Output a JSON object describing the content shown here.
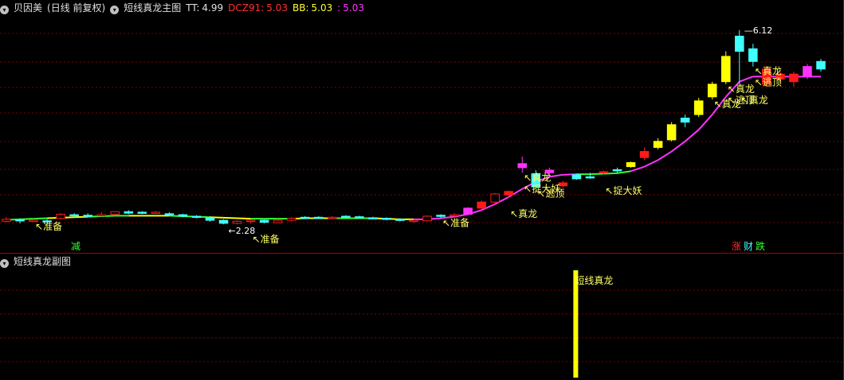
{
  "main_header": {
    "stock_name": "贝因美",
    "period": "(日线 前复权)",
    "indicator_name": "短线真龙主图",
    "tt_label": "TT:",
    "tt_value": "4.99",
    "dcz_label": "DCZ91:",
    "dcz_value": "5.03",
    "bb_label": "BB:",
    "bb_value": "5.03",
    "extra_label": ":",
    "extra_value": "5.03"
  },
  "sub_header": {
    "indicator_name": "短线真龙副图"
  },
  "bottom_tags": {
    "left": "减",
    "zhang": "涨",
    "cai": "财",
    "die": "跌"
  },
  "colors": {
    "up": "#ff1a1a",
    "down": "#40ffff",
    "yellow": "#ffff00",
    "magenta": "#ff33ff",
    "green": "#33ff33",
    "grid": "#7a0000",
    "annotation": "#ffff66",
    "price_label": "#ffffff"
  },
  "chart_data": {
    "type": "candlestick",
    "price_range": [
      2.0,
      6.4
    ],
    "candles": [
      {
        "o": 2.38,
        "h": 2.42,
        "l": 2.32,
        "c": 2.34
      },
      {
        "o": 2.36,
        "h": 2.4,
        "l": 2.3,
        "c": 2.37
      },
      {
        "o": 2.36,
        "h": 2.4,
        "l": 2.33,
        "c": 2.35
      },
      {
        "o": 2.35,
        "h": 2.38,
        "l": 2.3,
        "c": 2.33
      },
      {
        "o": 2.4,
        "h": 2.5,
        "l": 2.38,
        "c": 2.48
      },
      {
        "o": 2.47,
        "h": 2.5,
        "l": 2.43,
        "c": 2.45
      },
      {
        "o": 2.46,
        "h": 2.5,
        "l": 2.44,
        "c": 2.46
      },
      {
        "o": 2.47,
        "h": 2.52,
        "l": 2.45,
        "c": 2.47
      },
      {
        "o": 2.48,
        "h": 2.54,
        "l": 2.46,
        "c": 2.53
      },
      {
        "o": 2.53,
        "h": 2.56,
        "l": 2.48,
        "c": 2.5
      },
      {
        "o": 2.51,
        "h": 2.54,
        "l": 2.48,
        "c": 2.52
      },
      {
        "o": 2.52,
        "h": 2.54,
        "l": 2.49,
        "c": 2.51
      },
      {
        "o": 2.49,
        "h": 2.52,
        "l": 2.45,
        "c": 2.47
      },
      {
        "o": 2.47,
        "h": 2.49,
        "l": 2.42,
        "c": 2.44
      },
      {
        "o": 2.44,
        "h": 2.46,
        "l": 2.4,
        "c": 2.42
      },
      {
        "o": 2.41,
        "h": 2.44,
        "l": 2.33,
        "c": 2.36
      },
      {
        "o": 2.36,
        "h": 2.38,
        "l": 2.28,
        "c": 2.3
      },
      {
        "o": 2.3,
        "h": 2.36,
        "l": 2.28,
        "c": 2.34
      },
      {
        "o": 2.34,
        "h": 2.38,
        "l": 2.3,
        "c": 2.36
      },
      {
        "o": 2.36,
        "h": 2.38,
        "l": 2.3,
        "c": 2.32
      },
      {
        "o": 2.31,
        "h": 2.38,
        "l": 2.3,
        "c": 2.36
      },
      {
        "o": 2.36,
        "h": 2.42,
        "l": 2.34,
        "c": 2.4
      },
      {
        "o": 2.4,
        "h": 2.44,
        "l": 2.38,
        "c": 2.42
      },
      {
        "o": 2.42,
        "h": 2.44,
        "l": 2.4,
        "c": 2.41
      },
      {
        "o": 2.4,
        "h": 2.44,
        "l": 2.38,
        "c": 2.42
      },
      {
        "o": 2.42,
        "h": 2.46,
        "l": 2.4,
        "c": 2.44
      },
      {
        "o": 2.43,
        "h": 2.45,
        "l": 2.4,
        "c": 2.41
      },
      {
        "o": 2.41,
        "h": 2.43,
        "l": 2.38,
        "c": 2.4
      },
      {
        "o": 2.4,
        "h": 2.42,
        "l": 2.36,
        "c": 2.38
      },
      {
        "o": 2.38,
        "h": 2.4,
        "l": 2.34,
        "c": 2.36
      },
      {
        "o": 2.36,
        "h": 2.38,
        "l": 2.3,
        "c": 2.35
      },
      {
        "o": 2.35,
        "h": 2.46,
        "l": 2.34,
        "c": 2.44
      },
      {
        "o": 2.44,
        "h": 2.48,
        "l": 2.4,
        "c": 2.46
      },
      {
        "o": 2.46,
        "h": 2.5,
        "l": 2.43,
        "c": 2.47
      },
      {
        "o": 2.48,
        "h": 2.62,
        "l": 2.46,
        "c": 2.6
      },
      {
        "o": 2.6,
        "h": 2.75,
        "l": 2.58,
        "c": 2.72
      },
      {
        "o": 2.72,
        "h": 2.9,
        "l": 2.7,
        "c": 2.88
      },
      {
        "o": 2.86,
        "h": 2.95,
        "l": 2.8,
        "c": 2.93
      },
      {
        "o": 3.4,
        "h": 3.62,
        "l": 3.3,
        "c": 3.48
      },
      {
        "o": 3.28,
        "h": 3.35,
        "l": 2.98,
        "c": 3.02
      },
      {
        "o": 3.3,
        "h": 3.4,
        "l": 3.2,
        "c": 3.35
      },
      {
        "o": 3.1,
        "h": 3.14,
        "l": 3.0,
        "c": 3.04
      },
      {
        "o": 3.18,
        "h": 3.28,
        "l": 3.16,
        "c": 3.26
      },
      {
        "o": 3.22,
        "h": 3.3,
        "l": 3.18,
        "c": 3.2
      },
      {
        "o": 3.3,
        "h": 3.34,
        "l": 3.26,
        "c": 3.32
      },
      {
        "o": 3.34,
        "h": 3.4,
        "l": 3.3,
        "c": 3.36
      },
      {
        "o": 3.42,
        "h": 3.52,
        "l": 3.4,
        "c": 3.5
      },
      {
        "o": 3.6,
        "h": 3.8,
        "l": 3.55,
        "c": 3.72
      },
      {
        "o": 3.8,
        "h": 3.98,
        "l": 3.76,
        "c": 3.92
      },
      {
        "o": 3.95,
        "h": 4.3,
        "l": 3.92,
        "c": 4.25
      },
      {
        "o": 4.3,
        "h": 4.45,
        "l": 4.2,
        "c": 4.38
      },
      {
        "o": 4.45,
        "h": 4.78,
        "l": 4.4,
        "c": 4.72
      },
      {
        "o": 4.8,
        "h": 5.1,
        "l": 4.75,
        "c": 5.05
      },
      {
        "o": 5.1,
        "h": 5.7,
        "l": 5.05,
        "c": 5.6
      },
      {
        "o": 5.7,
        "h": 6.12,
        "l": 5.05,
        "c": 6.0
      },
      {
        "o": 5.75,
        "h": 5.85,
        "l": 5.4,
        "c": 5.5
      },
      {
        "o": 5.35,
        "h": 5.4,
        "l": 5.0,
        "c": 5.05
      },
      {
        "o": 5.25,
        "h": 5.35,
        "l": 5.1,
        "c": 5.15
      },
      {
        "o": 5.1,
        "h": 5.3,
        "l": 5.0,
        "c": 5.25
      },
      {
        "o": 5.2,
        "h": 5.45,
        "l": 5.15,
        "c": 5.4
      },
      {
        "o": 5.35,
        "h": 5.55,
        "l": 5.3,
        "c": 5.5
      }
    ],
    "candle_styles": [
      "up",
      "down",
      "up",
      "down",
      "up",
      "down",
      "down",
      "up",
      "up",
      "down",
      "down",
      "up",
      "down",
      "down",
      "down",
      "down",
      "down",
      "up",
      "up",
      "down",
      "up",
      "up",
      "down",
      "down",
      "up",
      "down",
      "down",
      "down",
      "down",
      "down",
      "up",
      "up",
      "down",
      "up",
      "magenta",
      "red",
      "up",
      "red",
      "magenta",
      "down",
      "magenta",
      "up",
      "down",
      "down",
      "up",
      "down",
      "yellow",
      "red",
      "yellow",
      "yellow",
      "down",
      "yellow",
      "yellow",
      "yellow",
      "down",
      "down",
      "red",
      "red",
      "red",
      "magenta",
      "down"
    ],
    "ma_line": [
      2.37,
      2.38,
      2.39,
      2.4,
      2.41,
      2.42,
      2.43,
      2.44,
      2.45,
      2.45,
      2.45,
      2.45,
      2.45,
      2.44,
      2.43,
      2.42,
      2.41,
      2.4,
      2.39,
      2.39,
      2.39,
      2.39,
      2.4,
      2.4,
      2.4,
      2.4,
      2.4,
      2.4,
      2.39,
      2.38,
      2.38,
      2.38,
      2.4,
      2.43,
      2.48,
      2.56,
      2.68,
      2.82,
      2.98,
      3.12,
      3.22,
      3.26,
      3.27,
      3.27,
      3.28,
      3.29,
      3.33,
      3.42,
      3.55,
      3.72,
      3.92,
      4.15,
      4.45,
      4.8,
      5.1,
      5.2,
      5.2,
      5.2,
      5.2,
      5.2,
      5.2
    ],
    "annotations": [
      {
        "i": 2,
        "text": "准备"
      },
      {
        "i": 18,
        "text": "准备"
      },
      {
        "i": 32,
        "text": "准备"
      },
      {
        "i": 37,
        "text": "真龙"
      },
      {
        "i": 38,
        "text": "真龙"
      },
      {
        "i": 38,
        "text": "捉大妖"
      },
      {
        "i": 39,
        "text": "逃顶"
      },
      {
        "i": 44,
        "text": "捉大妖"
      },
      {
        "i": 52,
        "text": "真龙"
      },
      {
        "i": 53,
        "text": "逃顶"
      },
      {
        "i": 53,
        "text": "真龙"
      },
      {
        "i": 54,
        "text": "真龙"
      },
      {
        "i": 55,
        "text": "真龙"
      },
      {
        "i": 55,
        "text": "逃顶"
      }
    ],
    "price_labels": [
      {
        "i": 54,
        "value": "6.12"
      },
      {
        "i": 16,
        "value": "2.28"
      }
    ],
    "sub_bar": {
      "label": "短线真龙",
      "i": 41
    }
  }
}
